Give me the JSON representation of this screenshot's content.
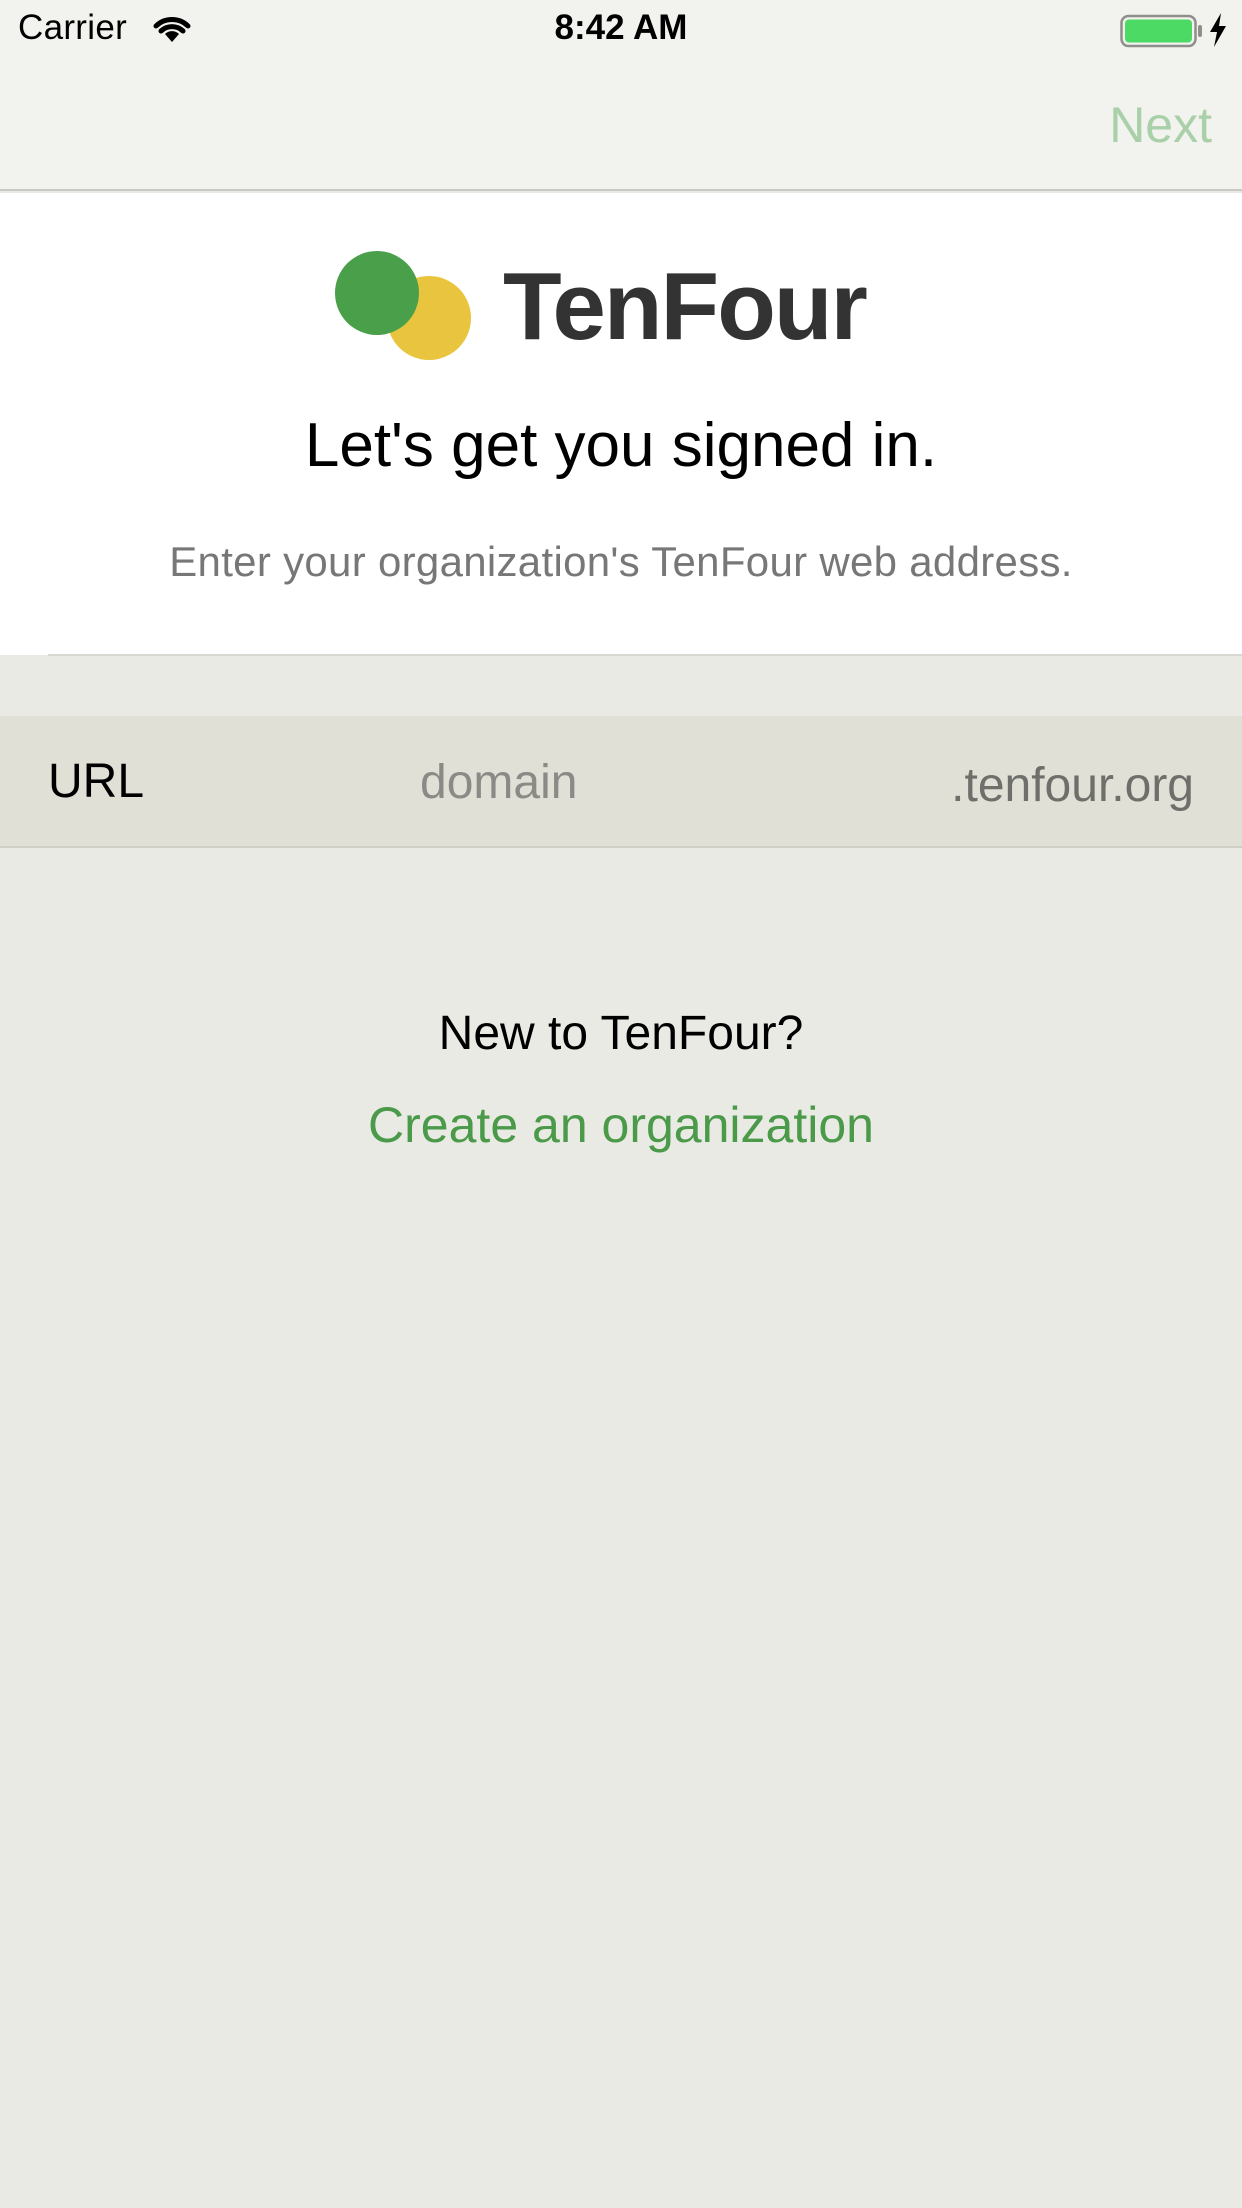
{
  "status_bar": {
    "carrier": "Carrier",
    "time": "8:42 AM",
    "battery_color": "#4cd964"
  },
  "nav": {
    "next_label": "Next",
    "next_color": "#a9d0a9"
  },
  "brand": {
    "name": "TenFour",
    "green": "#4a9f4a",
    "yellow": "#e9c43e"
  },
  "header": {
    "title": "Let's get you signed in.",
    "subtitle": "Enter your organization's TenFour web address."
  },
  "url_field": {
    "label": "URL",
    "placeholder": "domain",
    "value": "",
    "suffix": ".tenfour.org"
  },
  "footer": {
    "prompt": "New to TenFour?",
    "create_link": "Create an organization"
  }
}
